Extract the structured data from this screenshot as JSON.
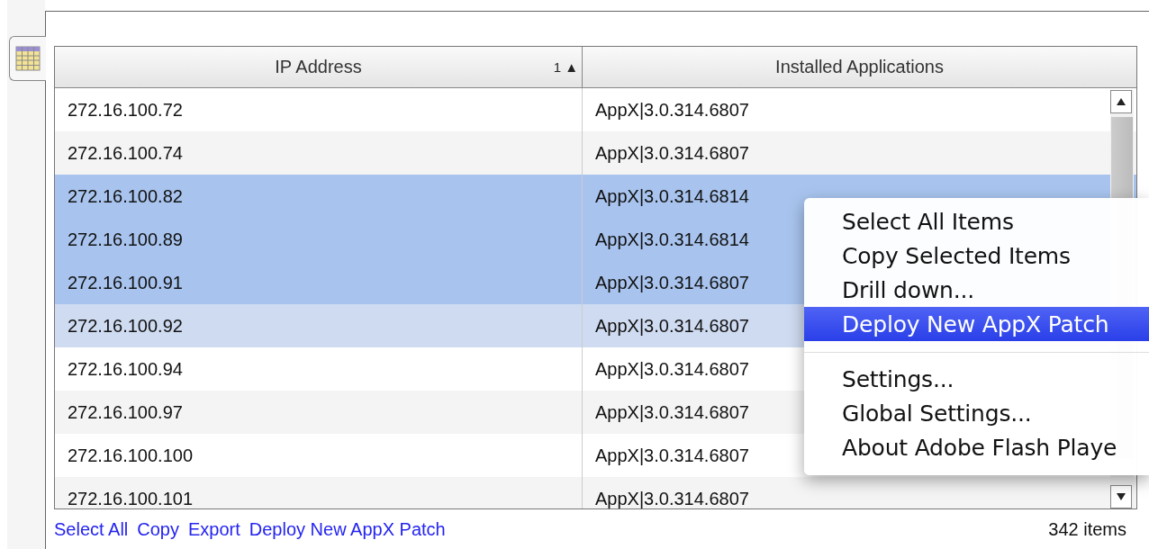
{
  "table": {
    "columns": [
      {
        "label": "IP Address",
        "sort_indicator": "1 ▲"
      },
      {
        "label": "Installed Applications"
      }
    ],
    "rows": [
      {
        "cells": [
          "272.16.100.72",
          "AppX|3.0.314.6807"
        ],
        "selected": false,
        "hovered": false
      },
      {
        "cells": [
          "272.16.100.74",
          "AppX|3.0.314.6807"
        ],
        "selected": false,
        "hovered": false
      },
      {
        "cells": [
          "272.16.100.82",
          "AppX|3.0.314.6814"
        ],
        "selected": true,
        "hovered": false
      },
      {
        "cells": [
          "272.16.100.89",
          "AppX|3.0.314.6814"
        ],
        "selected": true,
        "hovered": false
      },
      {
        "cells": [
          "272.16.100.91",
          "AppX|3.0.314.6807"
        ],
        "selected": true,
        "hovered": false
      },
      {
        "cells": [
          "272.16.100.92",
          "AppX|3.0.314.6807"
        ],
        "selected": false,
        "hovered": true
      },
      {
        "cells": [
          "272.16.100.94",
          "AppX|3.0.314.6807"
        ],
        "selected": false,
        "hovered": false
      },
      {
        "cells": [
          "272.16.100.97",
          "AppX|3.0.314.6807"
        ],
        "selected": false,
        "hovered": false
      },
      {
        "cells": [
          "272.16.100.100",
          "AppX|3.0.314.6807"
        ],
        "selected": false,
        "hovered": false
      },
      {
        "cells": [
          "272.16.100.101",
          "AppX|3.0.314.6807"
        ],
        "selected": false,
        "hovered": false
      }
    ]
  },
  "footer": {
    "links": [
      "Select All",
      "Copy",
      "Export",
      "Deploy New AppX Patch"
    ],
    "count": "342 items"
  },
  "context_menu": {
    "items": [
      {
        "kind": "item",
        "label": "Select All Items",
        "selected": false
      },
      {
        "kind": "item",
        "label": "Copy Selected Items",
        "selected": false
      },
      {
        "kind": "item",
        "label": "Drill down...",
        "selected": false
      },
      {
        "kind": "item",
        "label": "Deploy New AppX Patch",
        "selected": true
      },
      {
        "kind": "separator"
      },
      {
        "kind": "item",
        "label": "Settings...",
        "selected": false
      },
      {
        "kind": "item",
        "label": "Global Settings...",
        "selected": false
      },
      {
        "kind": "item",
        "label": "About Adobe Flash Playe",
        "selected": false
      }
    ]
  }
}
